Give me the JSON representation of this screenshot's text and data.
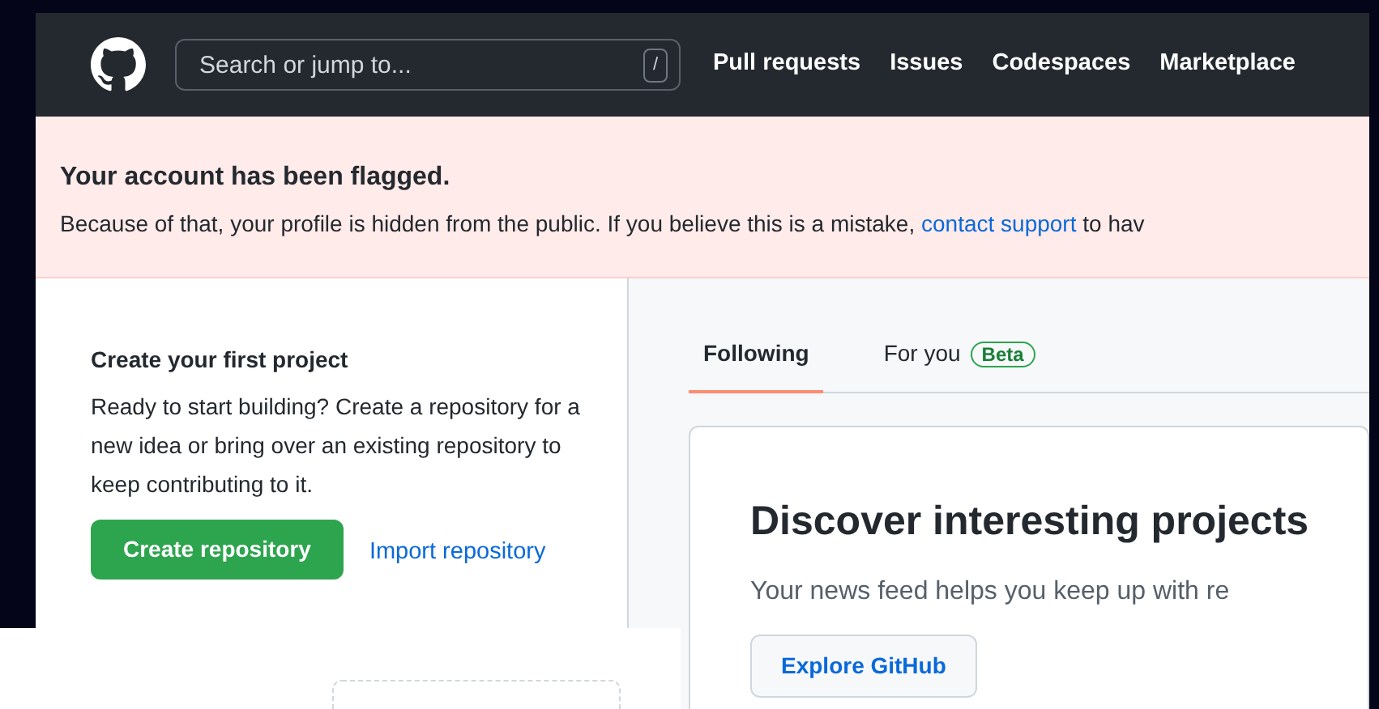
{
  "header": {
    "search": {
      "placeholder": "Search or jump to...",
      "shortcut": "/"
    },
    "nav": [
      "Pull requests",
      "Issues",
      "Codespaces",
      "Marketplace"
    ]
  },
  "banner": {
    "title": "Your account has been flagged.",
    "text_before": "Because of that, your profile is hidden from the public. If you believe this is a mistake, ",
    "link": "contact support",
    "text_after": " to hav"
  },
  "sidebar": {
    "title": "Create your first project",
    "description": "Ready to start building? Create a repository for a new idea or bring over an existing repository to keep contributing to it.",
    "primary_button": "Create repository",
    "secondary_link": "Import repository"
  },
  "feed": {
    "tabs": [
      {
        "label": "Following",
        "selected": true
      },
      {
        "label": "For you",
        "selected": false,
        "badge": "Beta"
      }
    ],
    "card": {
      "title": "Discover interesting projects",
      "text": "Your news feed helps you keep up with re",
      "button": "Explore GitHub"
    }
  }
}
